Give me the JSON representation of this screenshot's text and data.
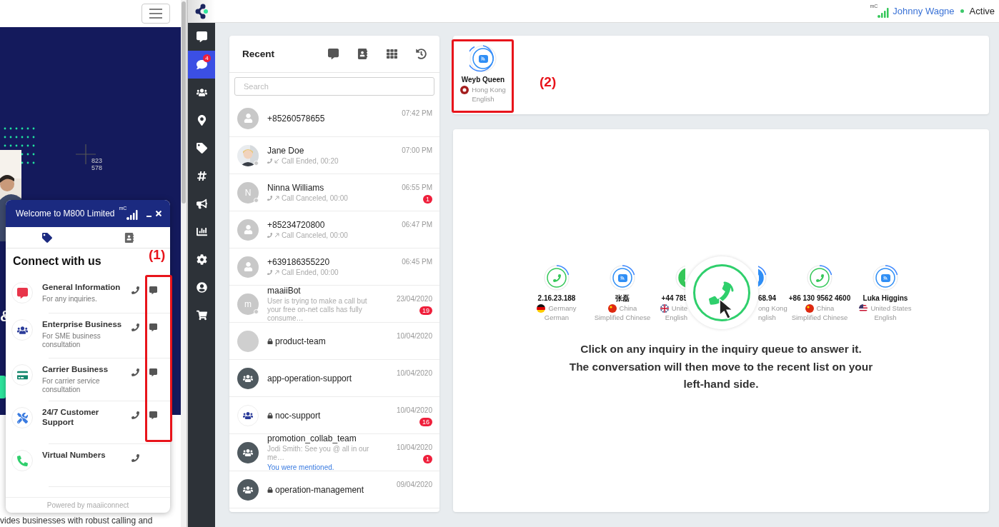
{
  "website": {
    "readout": [
      "823",
      "578"
    ],
    "hero_fragment": "&",
    "body_fragment": "vides businesses with robust calling and"
  },
  "widget": {
    "title": "Welcome to M800 Limited",
    "logo_text": "mC",
    "heading": "Connect with us",
    "annotation": "(1)",
    "footer": "Powered by maaiiconnect",
    "tabs": [
      {
        "kind": "services",
        "selected": true
      },
      {
        "kind": "contacts",
        "selected": false
      }
    ],
    "services": [
      {
        "kind": "info",
        "title": "General Information",
        "subtitle": "For any inquiries.",
        "chat": true
      },
      {
        "kind": "enterprise",
        "title": "Enterprise Business",
        "subtitle": "For SME business consultation",
        "chat": true
      },
      {
        "kind": "carrier",
        "title": "Carrier Business",
        "subtitle": "For carrier service consultation",
        "chat": true
      },
      {
        "kind": "support",
        "title": "24/7 Customer Support",
        "chat": true
      },
      {
        "kind": "numbers",
        "title": "Virtual Numbers",
        "chat": false
      }
    ]
  },
  "topbar": {
    "logo_text": "mC",
    "user": "Johnny Wagne",
    "status": "Active"
  },
  "sidebar": {
    "items": [
      {
        "kind": "conversations",
        "selected": false
      },
      {
        "kind": "chat",
        "selected": true,
        "badge": "4"
      },
      {
        "kind": "team",
        "selected": false
      },
      {
        "kind": "location",
        "selected": false
      },
      {
        "kind": "tags",
        "selected": false
      },
      {
        "kind": "channels",
        "selected": false
      },
      {
        "kind": "broadcast",
        "selected": false
      },
      {
        "kind": "reports",
        "selected": false
      },
      {
        "kind": "settings",
        "selected": false
      },
      {
        "kind": "profile",
        "selected": false
      },
      {
        "kind": "store",
        "selected": false
      }
    ]
  },
  "recent": {
    "title": "Recent",
    "search": {
      "placeholder": "Search"
    },
    "rows": [
      {
        "kind": "person",
        "name": "+85260578655",
        "time": "07:42 PM",
        "online": false,
        "locked": false
      },
      {
        "name": "Jane Doe",
        "call": {
          "kind": "incoming",
          "text": "Call Ended, 00:20"
        },
        "time": "07:00 PM",
        "online": true,
        "locked": false
      },
      {
        "kind": "letter",
        "initial": "N",
        "name": "Ninna Williams",
        "call": {
          "kind": "outgoing",
          "text": "Call Canceled, 00:00"
        },
        "time": "06:55 PM",
        "badge": "1",
        "online": true,
        "locked": false
      },
      {
        "kind": "person",
        "name": "+85234720800",
        "call": {
          "kind": "outgoing",
          "text": "Call Canceled, 00:00"
        },
        "time": "06:47 PM",
        "online": false,
        "locked": false
      },
      {
        "kind": "person",
        "name": "+639186355220",
        "call": {
          "kind": "outgoing",
          "text": "Call Ended, 00:00"
        },
        "time": "06:45 PM",
        "online": false,
        "locked": false
      },
      {
        "kind": "letter",
        "initial": "m",
        "name": "maaiiBot",
        "preview": "User is trying to make a call but your free on-net calls has fully consume…",
        "time": "23/04/2020",
        "badge": "19",
        "online": true,
        "locked": false
      },
      {
        "kind": "blank",
        "name": "product-team",
        "time": "10/04/2020",
        "online": false,
        "locked": true
      },
      {
        "kind": "group",
        "name": "app-operation-support",
        "time": "10/04/2020",
        "online": false,
        "locked": false
      },
      {
        "kind": "org",
        "name": "noc-support",
        "time": "10/04/2020",
        "badge": "16",
        "online": false,
        "locked": true
      },
      {
        "kind": "group",
        "name": "promotion_collab_team",
        "preview": "Jodi Smith: See you @ all in our me…",
        "mention": "You were mentioned.",
        "time": "10/04/2020",
        "badge": "1",
        "online": false,
        "locked": false
      },
      {
        "kind": "group",
        "name": "operation-management",
        "time": "09/04/2020",
        "online": false,
        "locked": true
      }
    ]
  },
  "queue": {
    "annotation": "(2)",
    "items": [
      {
        "kind": "chat",
        "name": "Weyb Queen",
        "flag": {
          "kind": "hk"
        },
        "country": "Hong Kong",
        "language": "English"
      }
    ]
  },
  "inquiries": {
    "items": [
      {
        "kind": "call",
        "name": "2.16.23.188",
        "flag": {
          "kind": "de"
        },
        "country": "Germany",
        "language": "German"
      },
      {
        "kind": "chat",
        "name": "张磊",
        "flag": {
          "kind": "cn"
        },
        "country": "China",
        "language": "Simplified Chinese"
      },
      {
        "kind": "call",
        "name": "+44 785",
        "flag": {
          "kind": "gb"
        },
        "country": "Unite",
        "language": "English"
      },
      {
        "kind": "focus"
      },
      {
        "kind": "chat",
        "name": "68.94",
        "country": "ong Kong",
        "language": "nglish"
      },
      {
        "kind": "call",
        "name": "+86 130 9562 4600",
        "flag": {
          "kind": "cn"
        },
        "country": "China",
        "language": "Simplified Chinese"
      },
      {
        "kind": "chat",
        "name": "Luka Higgins",
        "flag": {
          "kind": "us"
        },
        "country": "United States",
        "language": "English"
      }
    ],
    "message": [
      "Click on any inquiry in the inquiry queue to answer it.",
      "The conversation will then move to the recent list on your left-hand side."
    ]
  }
}
